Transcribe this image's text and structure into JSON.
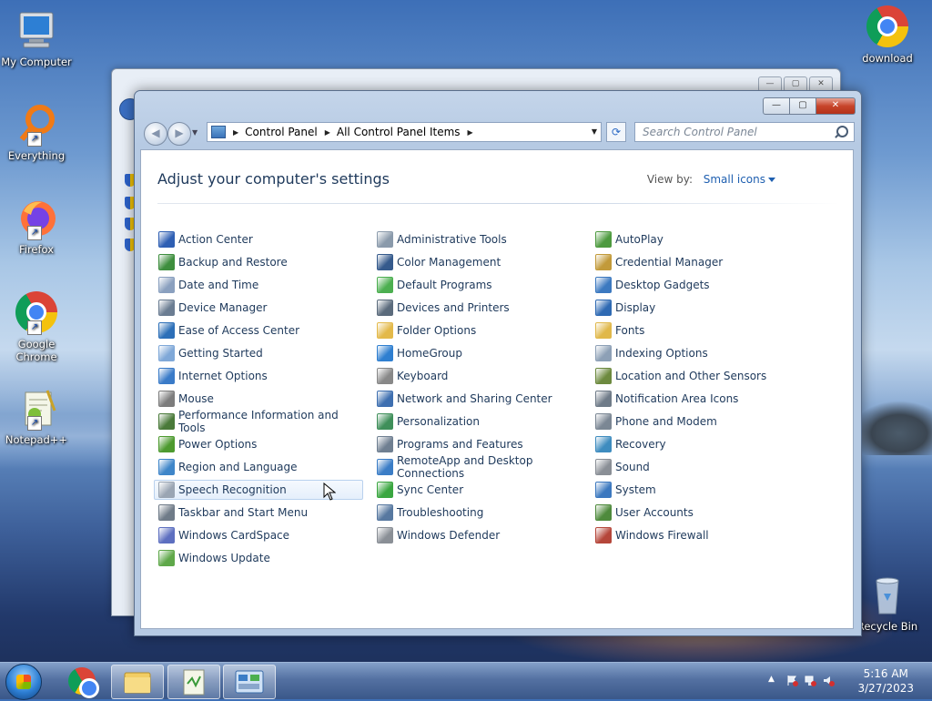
{
  "desktop": {
    "icons": [
      {
        "label": "My Computer",
        "icon": "computer-icon"
      },
      {
        "label": "Everything",
        "icon": "everything-icon"
      },
      {
        "label": "Firefox",
        "icon": "firefox-icon"
      },
      {
        "label": "Google Chrome",
        "icon": "chrome-icon"
      },
      {
        "label": "Notepad++",
        "icon": "notepadpp-icon"
      },
      {
        "label": "download",
        "icon": "chrome-icon"
      },
      {
        "label": "Recycle Bin",
        "icon": "recycle-bin-icon"
      }
    ]
  },
  "window": {
    "caption_buttons": {
      "minimize": "—",
      "maximize": "▢",
      "close": "✕"
    },
    "breadcrumb": [
      "Control Panel",
      "All Control Panel Items"
    ],
    "search_placeholder": "Search Control Panel",
    "heading": "Adjust your computer's settings",
    "view_by_label": "View by:",
    "view_by_value": "Small icons",
    "columns": [
      [
        {
          "label": "Action Center",
          "color": "#2f5fb3"
        },
        {
          "label": "Backup and Restore",
          "color": "#3e8e3e"
        },
        {
          "label": "Date and Time",
          "color": "#8aa0bf"
        },
        {
          "label": "Device Manager",
          "color": "#6b7d92"
        },
        {
          "label": "Ease of Access Center",
          "color": "#2c6fb8"
        },
        {
          "label": "Getting Started",
          "color": "#7fa8d8"
        },
        {
          "label": "Internet Options",
          "color": "#3a7bc8"
        },
        {
          "label": "Mouse",
          "color": "#7d7d7d"
        },
        {
          "label": "Performance Information and Tools",
          "color": "#4a7a3a"
        },
        {
          "label": "Power Options",
          "color": "#4d9a2f"
        },
        {
          "label": "Region and Language",
          "color": "#3f86c9"
        },
        {
          "label": "Speech Recognition",
          "color": "#9aa5b3"
        },
        {
          "label": "Taskbar and Start Menu",
          "color": "#6f7b88"
        },
        {
          "label": "Windows CardSpace",
          "color": "#5d6fc0"
        },
        {
          "label": "Windows Update",
          "color": "#5fa84a"
        }
      ],
      [
        {
          "label": "Administrative Tools",
          "color": "#8a9aab"
        },
        {
          "label": "Color Management",
          "color": "#355a8c"
        },
        {
          "label": "Default Programs",
          "color": "#4caf50"
        },
        {
          "label": "Devices and Printers",
          "color": "#5b6b7c"
        },
        {
          "label": "Folder Options",
          "color": "#e3b94a"
        },
        {
          "label": "HomeGroup",
          "color": "#2f7fd0"
        },
        {
          "label": "Keyboard",
          "color": "#888888"
        },
        {
          "label": "Network and Sharing Center",
          "color": "#3e6fb0"
        },
        {
          "label": "Personalization",
          "color": "#3f8f5a"
        },
        {
          "label": "Programs and Features",
          "color": "#6f7f91"
        },
        {
          "label": "RemoteApp and Desktop Connections",
          "color": "#3b7dc6"
        },
        {
          "label": "Sync Center",
          "color": "#3aa640"
        },
        {
          "label": "Troubleshooting",
          "color": "#5778a0"
        },
        {
          "label": "Windows Defender",
          "color": "#8a8f96"
        }
      ],
      [
        {
          "label": "AutoPlay",
          "color": "#4d9a3f"
        },
        {
          "label": "Credential Manager",
          "color": "#c29a3a"
        },
        {
          "label": "Desktop Gadgets",
          "color": "#3c79c0"
        },
        {
          "label": "Display",
          "color": "#2f6ab3"
        },
        {
          "label": "Fonts",
          "color": "#e0b84a"
        },
        {
          "label": "Indexing Options",
          "color": "#8da0b6"
        },
        {
          "label": "Location and Other Sensors",
          "color": "#6d8a3f"
        },
        {
          "label": "Notification Area Icons",
          "color": "#6f7b88"
        },
        {
          "label": "Phone and Modem",
          "color": "#7b8794"
        },
        {
          "label": "Recovery",
          "color": "#3e8cbf"
        },
        {
          "label": "Sound",
          "color": "#8a8f96"
        },
        {
          "label": "System",
          "color": "#3c78bf"
        },
        {
          "label": "User Accounts",
          "color": "#4e8a3c"
        },
        {
          "label": "Windows Firewall",
          "color": "#b5463a"
        }
      ]
    ]
  },
  "taskbar": {
    "buttons": [
      {
        "name": "chrome",
        "icon": "chrome-icon"
      },
      {
        "name": "explorer",
        "icon": "folder-icon"
      },
      {
        "name": "notepadpp",
        "icon": "notepadpp-icon"
      },
      {
        "name": "control-panel",
        "icon": "control-panel-icon"
      }
    ],
    "clock_time": "5:16 AM",
    "clock_date": "3/27/2023"
  }
}
